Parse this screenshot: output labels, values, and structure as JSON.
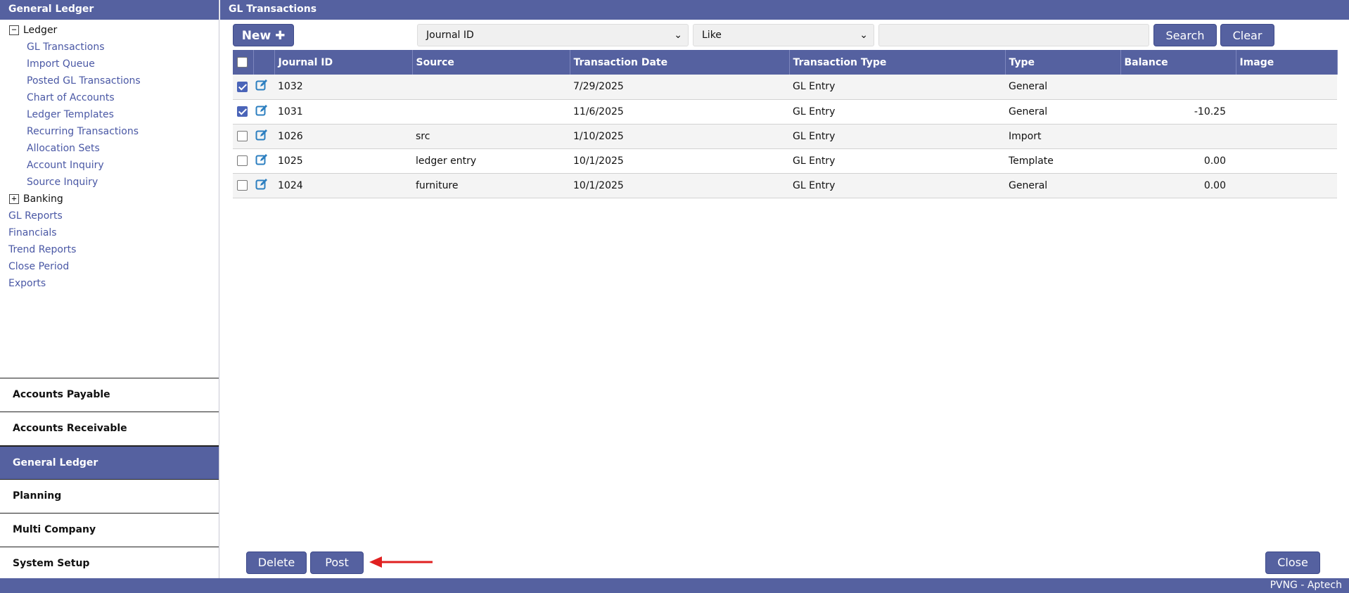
{
  "sidebar": {
    "title": "General Ledger",
    "tree": {
      "ledger": {
        "label": "Ledger",
        "toggle": "−",
        "items": [
          "GL Transactions",
          "Import Queue",
          "Posted GL Transactions",
          "Chart of Accounts",
          "Ledger Templates",
          "Recurring Transactions",
          "Allocation Sets",
          "Account Inquiry",
          "Source Inquiry"
        ]
      },
      "banking": {
        "label": "Banking",
        "toggle": "+"
      },
      "top_items": [
        "GL Reports",
        "Financials",
        "Trend Reports",
        "Close Period",
        "Exports"
      ]
    },
    "modules": [
      "Accounts Payable",
      "Accounts Receivable",
      "General Ledger",
      "Planning",
      "Multi Company",
      "System Setup"
    ],
    "active_module": "General Ledger"
  },
  "main": {
    "title": "GL Transactions",
    "toolbar": {
      "new_label": "New ✚",
      "field_select": "Journal ID",
      "operator_select": "Like",
      "search_value": "",
      "search_label": "Search",
      "clear_label": "Clear"
    },
    "grid": {
      "columns": [
        "Journal ID",
        "Source",
        "Transaction Date",
        "Transaction Type",
        "Type",
        "Balance",
        "Image"
      ],
      "rows": [
        {
          "checked": true,
          "journal_id": "1032",
          "source": "",
          "date": "7/29/2025",
          "trans_type": "GL Entry",
          "type": "General",
          "balance": "",
          "image": ""
        },
        {
          "checked": true,
          "journal_id": "1031",
          "source": "",
          "date": "11/6/2025",
          "trans_type": "GL Entry",
          "type": "General",
          "balance": "-10.25",
          "image": ""
        },
        {
          "checked": false,
          "journal_id": "1026",
          "source": "src",
          "date": "1/10/2025",
          "trans_type": "GL Entry",
          "type": "Import",
          "balance": "",
          "image": ""
        },
        {
          "checked": false,
          "journal_id": "1025",
          "source": "ledger entry",
          "date": "10/1/2025",
          "trans_type": "GL Entry",
          "type": "Template",
          "balance": "0.00",
          "image": ""
        },
        {
          "checked": false,
          "journal_id": "1024",
          "source": "furniture",
          "date": "10/1/2025",
          "trans_type": "GL Entry",
          "type": "General",
          "balance": "0.00",
          "image": ""
        }
      ]
    },
    "footer": {
      "delete_label": "Delete",
      "post_label": "Post",
      "close_label": "Close"
    }
  },
  "statusbar": {
    "text": "PVNG - Aptech"
  },
  "colors": {
    "accent": "#5561a0",
    "link": "#4a58a5",
    "annotation_arrow": "#e02020",
    "check": "#4a64b8"
  },
  "icons": {
    "edit": "edit-icon",
    "arrow": "red-arrow-annotation-icon",
    "caret": "chevron-down-icon"
  }
}
